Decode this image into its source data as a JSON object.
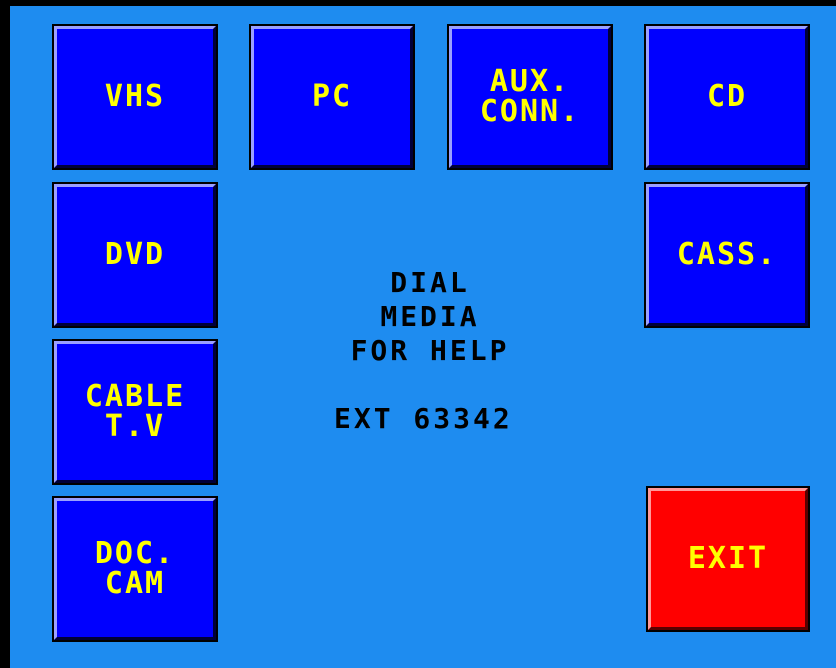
{
  "buttons": {
    "vhs": {
      "lines": [
        "VHS"
      ]
    },
    "pc": {
      "lines": [
        "PC"
      ]
    },
    "aux": {
      "lines": [
        "AUX.",
        "CONN."
      ]
    },
    "cd": {
      "lines": [
        "CD"
      ]
    },
    "dvd": {
      "lines": [
        "DVD"
      ]
    },
    "cass": {
      "lines": [
        "CASS."
      ]
    },
    "cable": {
      "lines": [
        "CABLE",
        "T.V"
      ]
    },
    "doccam": {
      "lines": [
        "DOC.",
        "CAM"
      ]
    },
    "exit": {
      "lines": [
        "EXIT"
      ]
    }
  },
  "help": {
    "lines": [
      "DIAL",
      "MEDIA",
      "FOR HELP"
    ],
    "extension": "EXT 63342"
  },
  "colors": {
    "panel_background": "#1e8cf0",
    "button_blue": "#0000ff",
    "button_red": "#ff0000",
    "label_yellow": "#ffff00",
    "help_text": "#000000"
  }
}
